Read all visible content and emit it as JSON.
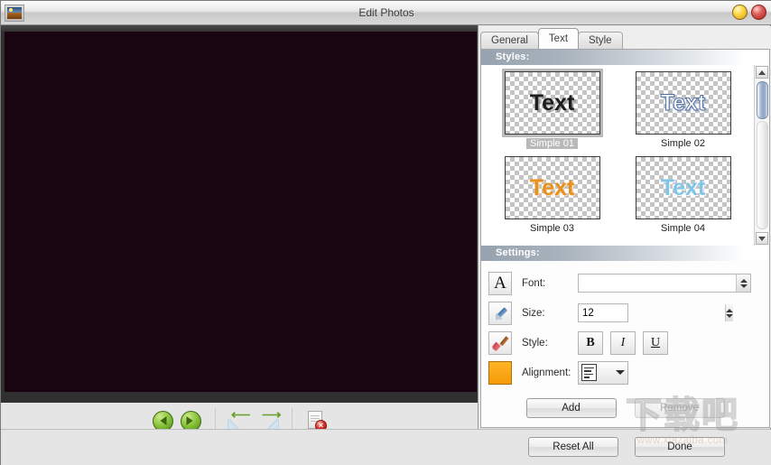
{
  "window": {
    "title": "Edit Photos",
    "icon": "photo-icon",
    "buttons": [
      {
        "name": "minimize",
        "color": "#ffd94b"
      },
      {
        "name": "close",
        "color": "#e0615b"
      }
    ]
  },
  "canvas": {
    "background": "#190512",
    "frame": "#2f2f2f"
  },
  "toolbar": {
    "items": [
      {
        "name": "previous-photo-button",
        "icon": "arrow-left-circle-icon"
      },
      {
        "name": "next-photo-button",
        "icon": "arrow-right-circle-icon"
      },
      {
        "name": "rotate-left-button",
        "icon": "rotate-left-icon"
      },
      {
        "name": "rotate-right-button",
        "icon": "rotate-right-icon"
      },
      {
        "name": "delete-photo-button",
        "icon": "document-delete-icon"
      }
    ]
  },
  "panel": {
    "tabs": [
      {
        "label": "General",
        "active": false
      },
      {
        "label": "Text",
        "active": true
      },
      {
        "label": "Style",
        "active": false
      }
    ],
    "styles_section": {
      "header": "Styles:",
      "items": [
        {
          "label": "Simple 01",
          "sample": "Text",
          "variant": "t1",
          "selected": true
        },
        {
          "label": "Simple 02",
          "sample": "Text",
          "variant": "t2",
          "selected": false
        },
        {
          "label": "Simple 03",
          "sample": "Text",
          "variant": "t3",
          "selected": false
        },
        {
          "label": "Simple 04",
          "sample": "Text",
          "variant": "t4",
          "selected": false
        }
      ]
    },
    "settings_section": {
      "header": "Settings:",
      "font": {
        "label": "Font:",
        "value": "",
        "placeholder": "",
        "icon": "letter-a-icon"
      },
      "size": {
        "label": "Size:",
        "value": "12",
        "icon": "pen-icon"
      },
      "style": {
        "label": "Style:",
        "icon": "brush-icon",
        "buttons": [
          {
            "name": "bold-button",
            "label": "B"
          },
          {
            "name": "italic-button",
            "label": "I"
          },
          {
            "name": "underline-button",
            "label": "U"
          }
        ]
      },
      "alignment": {
        "label": "Alignment:",
        "icon": "color-swatch-icon",
        "value_icon": "align-left-icon"
      }
    },
    "actions": {
      "add": "Add",
      "remove": "Remove",
      "remove_disabled": true
    }
  },
  "footer": {
    "reset_all": "Reset All",
    "done": "Done"
  },
  "watermark": {
    "characters": "下载吧",
    "url": "www.xiazaiba.com"
  }
}
